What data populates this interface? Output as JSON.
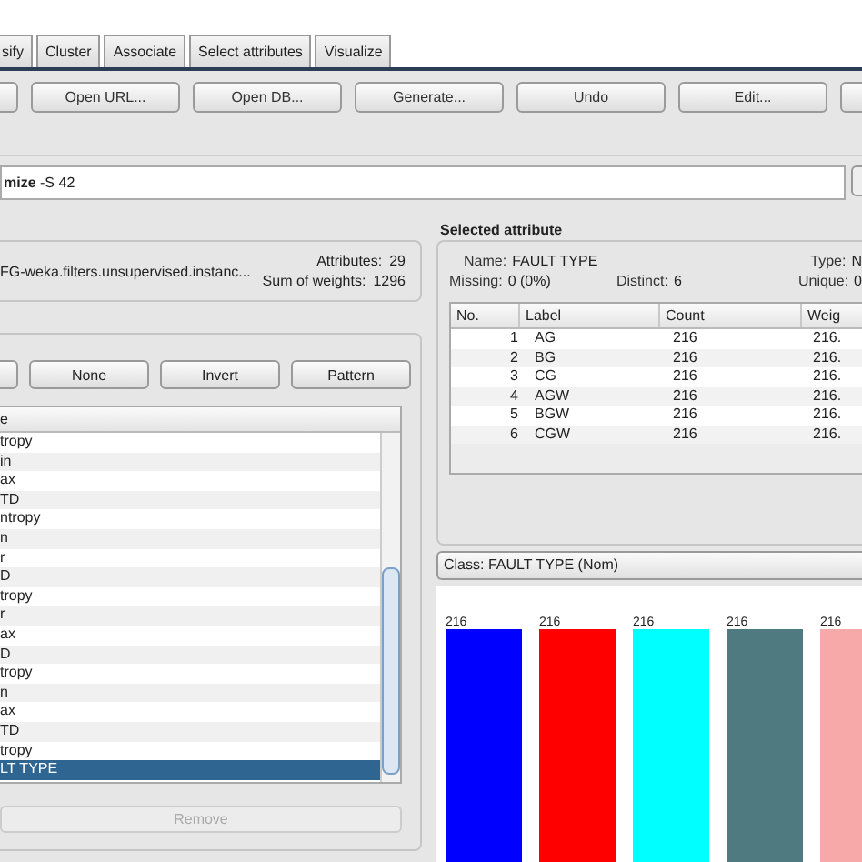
{
  "tabs": [
    {
      "label": "sify",
      "selected": false
    },
    {
      "label": "Cluster",
      "selected": false
    },
    {
      "label": "Associate",
      "selected": false
    },
    {
      "label": "Select attributes",
      "selected": false
    },
    {
      "label": "Visualize",
      "selected": false
    }
  ],
  "toolbar": {
    "buttons": [
      "Open URL...",
      "Open DB...",
      "Generate...",
      "Undo",
      "Edit..."
    ]
  },
  "filter": {
    "value": "**mize** -S 42"
  },
  "relation": {
    "name": "FG-weka.filters.unsupervised.instanc...",
    "attributes_label": "Attributes:",
    "attributes": "29",
    "weights_label": "Sum of weights:",
    "weights": "1296"
  },
  "attributes": {
    "buttons": [
      "None",
      "Invert",
      "Pattern"
    ],
    "header": "e",
    "rows": [
      {
        "name": "tropy",
        "selected": false
      },
      {
        "name": "in",
        "selected": false
      },
      {
        "name": "ax",
        "selected": false
      },
      {
        "name": "TD",
        "selected": false
      },
      {
        "name": "ntropy",
        "selected": false
      },
      {
        "name": "n",
        "selected": false
      },
      {
        "name": "r",
        "selected": false
      },
      {
        "name": "D",
        "selected": false
      },
      {
        "name": "tropy",
        "selected": false
      },
      {
        "name": "r",
        "selected": false
      },
      {
        "name": "ax",
        "selected": false
      },
      {
        "name": "D",
        "selected": false
      },
      {
        "name": "tropy",
        "selected": false
      },
      {
        "name": "n",
        "selected": false
      },
      {
        "name": "ax",
        "selected": false
      },
      {
        "name": "TD",
        "selected": false
      },
      {
        "name": "tropy",
        "selected": false
      },
      {
        "name": "LT TYPE",
        "selected": true
      }
    ],
    "remove": {
      "label": "Remove",
      "disabled": true
    }
  },
  "selected_attribute": {
    "title": "Selected attribute",
    "name_label": "Name:",
    "name": "FAULT TYPE",
    "type_label": "Type:",
    "type": "N",
    "missing_label": "Missing:",
    "missing": "0 (0%)",
    "distinct_label": "Distinct:",
    "distinct": "6",
    "unique_label": "Unique:",
    "unique": "0",
    "columns": [
      "No.",
      "Label",
      "Count",
      "Weig"
    ],
    "rows": [
      [
        "1",
        "AG",
        "216",
        "216."
      ],
      [
        "2",
        "BG",
        "216",
        "216."
      ],
      [
        "3",
        "CG",
        "216",
        "216."
      ],
      [
        "4",
        "AGW",
        "216",
        "216."
      ],
      [
        "5",
        "BGW",
        "216",
        "216."
      ],
      [
        "6",
        "CGW",
        "216",
        "216."
      ]
    ]
  },
  "class_select": {
    "value": "Class: FAULT TYPE (Nom)"
  },
  "chart": {
    "chart_data": {
      "type": "bar",
      "values": [
        216,
        216,
        216,
        216,
        216
      ],
      "data_labels": true,
      "colors": [
        "#0000ff",
        "#ff0000",
        "#00ffff",
        "#4f7a7f",
        "#f7a8a8"
      ]
    }
  }
}
